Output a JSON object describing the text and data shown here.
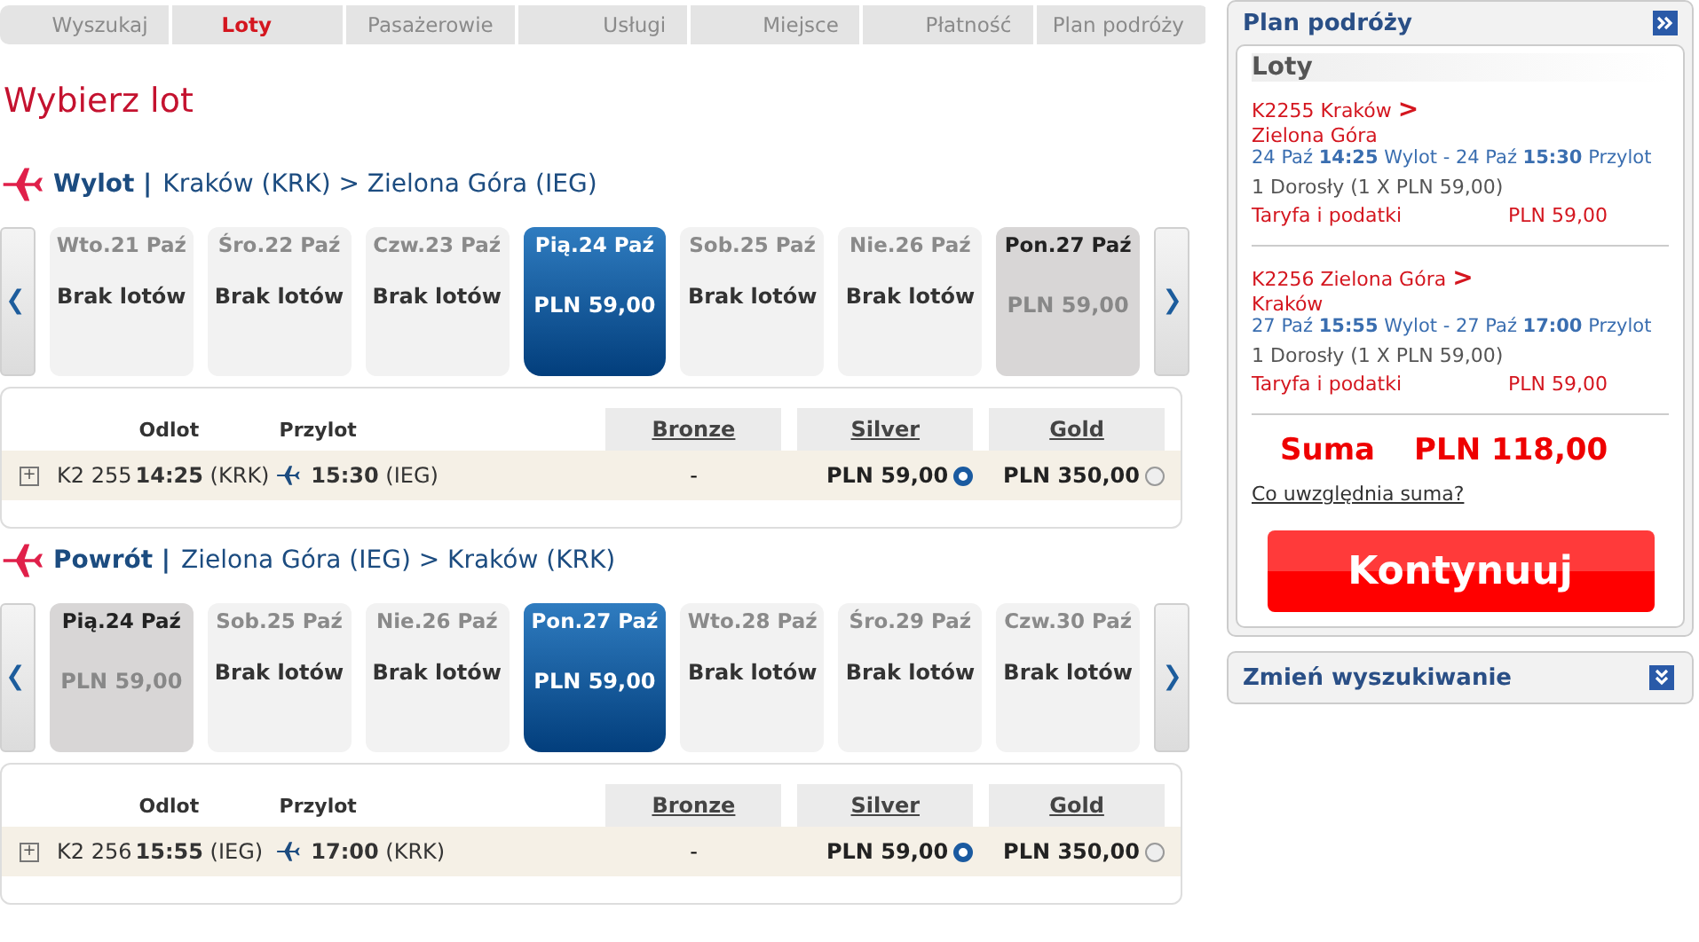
{
  "steps": [
    {
      "label": "Wyszukaj",
      "selected": false
    },
    {
      "label": "Loty",
      "selected": true
    },
    {
      "label": "Pasażerowie",
      "selected": false
    },
    {
      "label": "Usługi",
      "selected": false
    },
    {
      "label": "Miejsce",
      "selected": false
    },
    {
      "label": "Płatność",
      "selected": false
    },
    {
      "label": "Plan podróży",
      "selected": false
    }
  ],
  "title": "Wybierz lot",
  "legs": [
    {
      "label": "Wylot |",
      "route": "Kraków (KRK) > Zielona Góra (IEG)",
      "days": [
        {
          "date": "Wto.21 Paź",
          "kind": "none",
          "text": "Brak lotów",
          "selected": false
        },
        {
          "date": "Śro.22 Paź",
          "kind": "none",
          "text": "Brak lotów",
          "selected": false
        },
        {
          "date": "Czw.23 Paź",
          "kind": "none",
          "text": "Brak lotów",
          "selected": false
        },
        {
          "date": "Pią.24 Paź",
          "kind": "price",
          "text": "PLN 59,00",
          "selected": true
        },
        {
          "date": "Sob.25 Paź",
          "kind": "none",
          "text": "Brak lotów",
          "selected": false
        },
        {
          "date": "Nie.26 Paź",
          "kind": "none",
          "text": "Brak lotów",
          "selected": false
        },
        {
          "date": "Pon.27 Paź",
          "kind": "price",
          "text": "PLN 59,00",
          "selected": false
        }
      ],
      "columns": {
        "depart": "Odlot",
        "arrive": "Przylot",
        "fares": [
          "Bronze",
          "Silver",
          "Gold"
        ]
      },
      "flight": {
        "expand": "+",
        "number": "K2 255",
        "dep_time": "14:25",
        "dep_code": "(KRK)",
        "arr_time": "15:30",
        "arr_code": "(IEG)",
        "fares": [
          {
            "price": "-",
            "kind": "empty"
          },
          {
            "price": "PLN 59,00",
            "kind": "radio",
            "selected": true
          },
          {
            "price": "PLN 350,00",
            "kind": "radio",
            "selected": false
          }
        ]
      }
    },
    {
      "label": "Powrót |",
      "route": "Zielona Góra (IEG) > Kraków (KRK)",
      "days": [
        {
          "date": "Pią.24 Paź",
          "kind": "price",
          "text": "PLN 59,00",
          "selected": false
        },
        {
          "date": "Sob.25 Paź",
          "kind": "none",
          "text": "Brak lotów",
          "selected": false
        },
        {
          "date": "Nie.26 Paź",
          "kind": "none",
          "text": "Brak lotów",
          "selected": false
        },
        {
          "date": "Pon.27 Paź",
          "kind": "price",
          "text": "PLN 59,00",
          "selected": true
        },
        {
          "date": "Wto.28 Paź",
          "kind": "none",
          "text": "Brak lotów",
          "selected": false
        },
        {
          "date": "Śro.29 Paź",
          "kind": "none",
          "text": "Brak lotów",
          "selected": false
        },
        {
          "date": "Czw.30 Paź",
          "kind": "none",
          "text": "Brak lotów",
          "selected": false
        }
      ],
      "columns": {
        "depart": "Odlot",
        "arrive": "Przylot",
        "fares": [
          "Bronze",
          "Silver",
          "Gold"
        ]
      },
      "flight": {
        "expand": "+",
        "number": "K2 256",
        "dep_time": "15:55",
        "dep_code": "(IEG)",
        "arr_time": "17:00",
        "arr_code": "(KRK)",
        "fares": [
          {
            "price": "-",
            "kind": "empty"
          },
          {
            "price": "PLN 59,00",
            "kind": "radio",
            "selected": true
          },
          {
            "price": "PLN 350,00",
            "kind": "radio",
            "selected": false
          }
        ]
      }
    }
  ],
  "plan": {
    "title": "Plan podróży",
    "section": "Loty",
    "items": [
      {
        "head": "K2255 Kraków",
        "arrow": ">",
        "dest": "Zielona Góra",
        "times": "24 Paź **14:25** Wylot - 24 Paź **15:30** Przylot",
        "pax": "1 Dorosły (1 X PLN 59,00)",
        "fee_label": "Taryfa i podatki",
        "fee": "PLN 59,00"
      },
      {
        "head": "K2256 Zielona Góra",
        "arrow": ">",
        "dest": "Kraków",
        "times": "27 Paź **15:55** Wylot - 27 Paź **17:00** Przylot",
        "pax": "1 Dorosły (1 X PLN 59,00)",
        "fee_label": "Taryfa i podatki",
        "fee": "PLN 59,00"
      }
    ],
    "sum_label": "Suma",
    "sum": "PLN 118,00",
    "sum_link": "Co uwzględnia suma?",
    "continue": "Kontynuuj"
  },
  "change_search": "Zmień wyszukiwanie"
}
